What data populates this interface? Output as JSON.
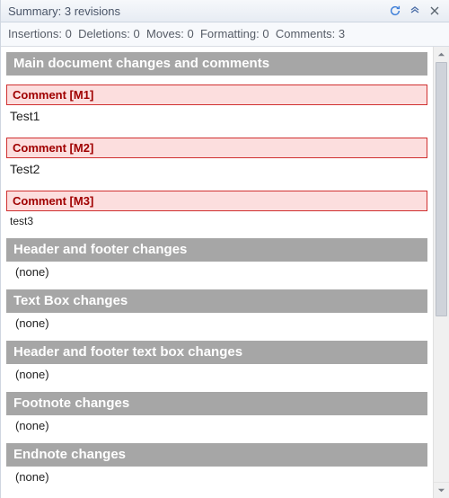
{
  "titlebar": {
    "summary_label": "Summary:",
    "revision_count": 3,
    "revision_word": "revisions"
  },
  "icons": {
    "refresh": "refresh-icon",
    "collapse": "collapse-icon",
    "close": "close-icon"
  },
  "stats": {
    "insertions_label": "Insertions:",
    "insertions": 0,
    "deletions_label": "Deletions:",
    "deletions": 0,
    "moves_label": "Moves:",
    "moves": 0,
    "formatting_label": "Formatting:",
    "formatting": 0,
    "comments_label": "Comments:",
    "comments": 3
  },
  "sections": {
    "main": {
      "title": "Main document changes and comments",
      "comments": [
        {
          "tag": "Comment [M1]",
          "text": "Test1",
          "small": false
        },
        {
          "tag": "Comment [M2]",
          "text": "Test2",
          "small": false
        },
        {
          "tag": "Comment [M3]",
          "text": "test3",
          "small": true
        }
      ]
    },
    "header_footer": {
      "title": "Header and footer changes",
      "none": "(none)"
    },
    "text_box": {
      "title": "Text Box changes",
      "none": "(none)"
    },
    "header_footer_textbox": {
      "title": "Header and footer text box changes",
      "none": "(none)"
    },
    "footnote": {
      "title": "Footnote changes",
      "none": "(none)"
    },
    "endnote": {
      "title": "Endnote changes",
      "none": "(none)"
    }
  }
}
